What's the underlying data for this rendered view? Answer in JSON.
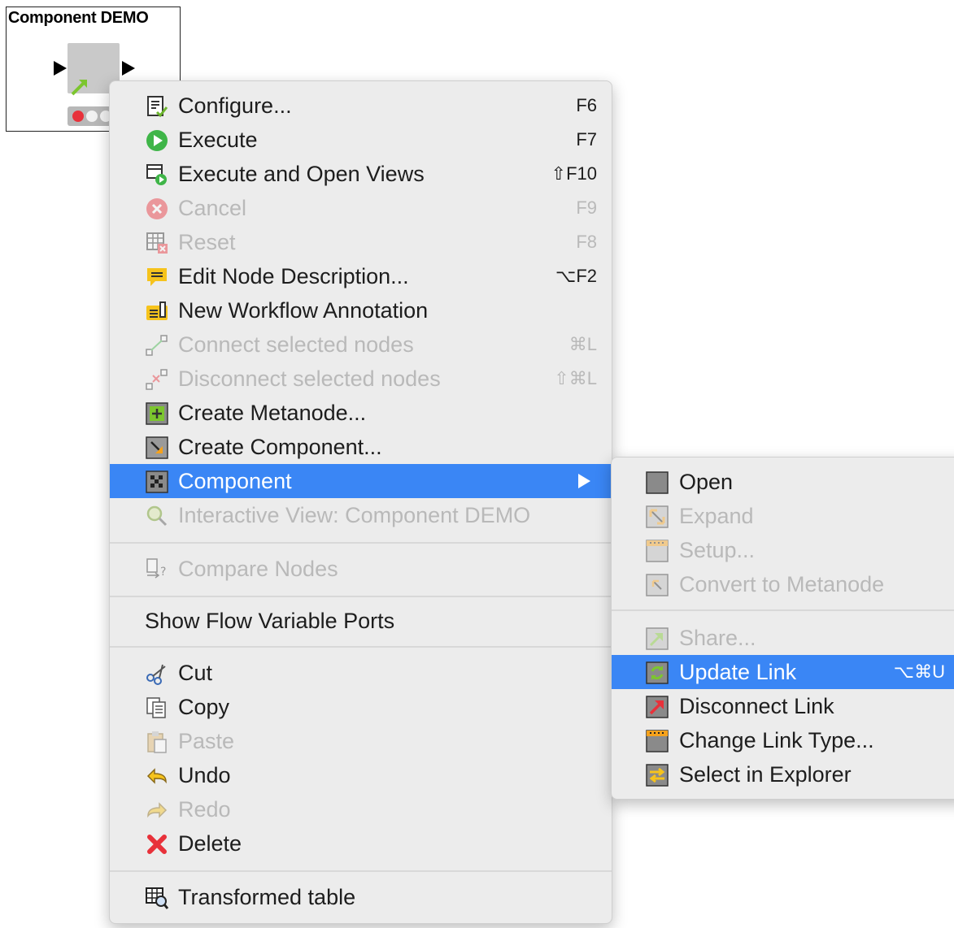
{
  "node": {
    "title": "Component DEMO",
    "status_colors": [
      "#e8313a",
      "#f0f0f0",
      "#f0f0f0"
    ]
  },
  "main_menu": {
    "items": [
      {
        "label": "Configure...",
        "shortcut": "F6",
        "icon": "configure-icon",
        "enabled": true
      },
      {
        "label": "Execute",
        "shortcut": "F7",
        "icon": "execute-icon",
        "enabled": true
      },
      {
        "label": "Execute and Open Views",
        "shortcut": "⇧F10",
        "icon": "execute-open-views-icon",
        "enabled": true
      },
      {
        "label": "Cancel",
        "shortcut": "F9",
        "icon": "cancel-icon",
        "enabled": false
      },
      {
        "label": "Reset",
        "shortcut": "F8",
        "icon": "reset-icon",
        "enabled": false
      },
      {
        "label": "Edit Node Description...",
        "shortcut": "⌥F2",
        "icon": "edit-description-icon",
        "enabled": true
      },
      {
        "label": "New Workflow Annotation",
        "shortcut": "",
        "icon": "annotation-icon",
        "enabled": true
      },
      {
        "label": "Connect selected nodes",
        "shortcut": "⌘L",
        "icon": "connect-nodes-icon",
        "enabled": false
      },
      {
        "label": "Disconnect selected nodes",
        "shortcut": "⇧⌘L",
        "icon": "disconnect-nodes-icon",
        "enabled": false
      },
      {
        "label": "Create Metanode...",
        "shortcut": "",
        "icon": "create-metanode-icon",
        "enabled": true
      },
      {
        "label": "Create Component...",
        "shortcut": "",
        "icon": "create-component-icon",
        "enabled": true
      },
      {
        "label": "Component",
        "shortcut": "",
        "icon": "component-icon",
        "enabled": true,
        "highlighted": true
      },
      {
        "label": "Interactive View: Component DEMO",
        "shortcut": "",
        "icon": "magnifier-icon",
        "enabled": false
      },
      {
        "label": "Compare Nodes",
        "shortcut": "",
        "icon": "compare-nodes-icon",
        "enabled": false
      },
      {
        "label": "Show Flow Variable Ports",
        "shortcut": "",
        "icon": "",
        "enabled": true
      },
      {
        "label": "Cut",
        "shortcut": "",
        "icon": "scissors-icon",
        "enabled": true
      },
      {
        "label": "Copy",
        "shortcut": "",
        "icon": "copy-icon",
        "enabled": true
      },
      {
        "label": "Paste",
        "shortcut": "",
        "icon": "paste-icon",
        "enabled": false
      },
      {
        "label": "Undo",
        "shortcut": "",
        "icon": "undo-icon",
        "enabled": true
      },
      {
        "label": "Redo",
        "shortcut": "",
        "icon": "redo-icon",
        "enabled": false
      },
      {
        "label": "Delete",
        "shortcut": "",
        "icon": "delete-icon",
        "enabled": true
      },
      {
        "label": "Transformed table",
        "shortcut": "",
        "icon": "table-view-icon",
        "enabled": true
      }
    ]
  },
  "sub_menu": {
    "items": [
      {
        "label": "Open",
        "shortcut": "",
        "icon": "open-icon",
        "enabled": true
      },
      {
        "label": "Expand",
        "shortcut": "",
        "icon": "expand-icon",
        "enabled": false
      },
      {
        "label": "Setup...",
        "shortcut": "",
        "icon": "setup-icon",
        "enabled": false
      },
      {
        "label": "Convert to Metanode",
        "shortcut": "",
        "icon": "convert-icon",
        "enabled": false
      },
      {
        "label": "Share...",
        "shortcut": "",
        "icon": "share-icon",
        "enabled": false
      },
      {
        "label": "Update Link",
        "shortcut": "⌥⌘U",
        "icon": "update-link-icon",
        "enabled": true,
        "highlighted": true
      },
      {
        "label": "Disconnect Link",
        "shortcut": "",
        "icon": "disconnect-link-icon",
        "enabled": true
      },
      {
        "label": "Change Link Type...",
        "shortcut": "",
        "icon": "change-link-type-icon",
        "enabled": true
      },
      {
        "label": "Select in Explorer",
        "shortcut": "",
        "icon": "select-explorer-icon",
        "enabled": true
      }
    ]
  },
  "colors": {
    "highlight": "#3a86f5",
    "menu_bg": "#ececec",
    "disabled_text": "#b9b9b9"
  }
}
